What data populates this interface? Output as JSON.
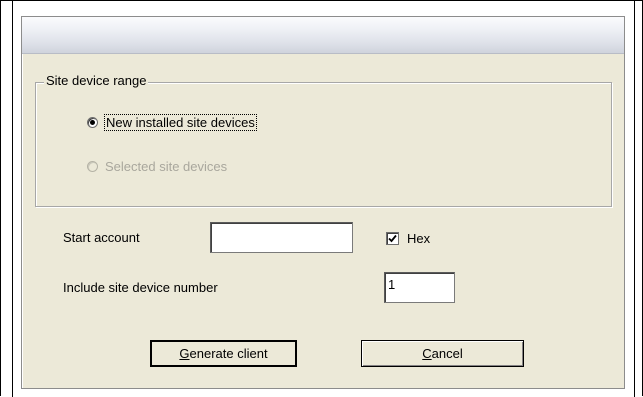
{
  "dialog": {
    "title": ""
  },
  "site_device_range": {
    "group_label": "Site device range",
    "options": [
      {
        "label": "New installed site devices",
        "selected": true,
        "enabled": true
      },
      {
        "label": "Selected site devices",
        "selected": false,
        "enabled": false
      }
    ]
  },
  "start_account": {
    "label": "Start account",
    "value": ""
  },
  "hex": {
    "label": "Hex",
    "checked": true
  },
  "include_site_device_number": {
    "label": "Include site device number",
    "value": "1"
  },
  "buttons": {
    "generate_mnemonic": "G",
    "generate_rest": "enerate client",
    "cancel_mnemonic": "C",
    "cancel_rest": "ancel"
  }
}
